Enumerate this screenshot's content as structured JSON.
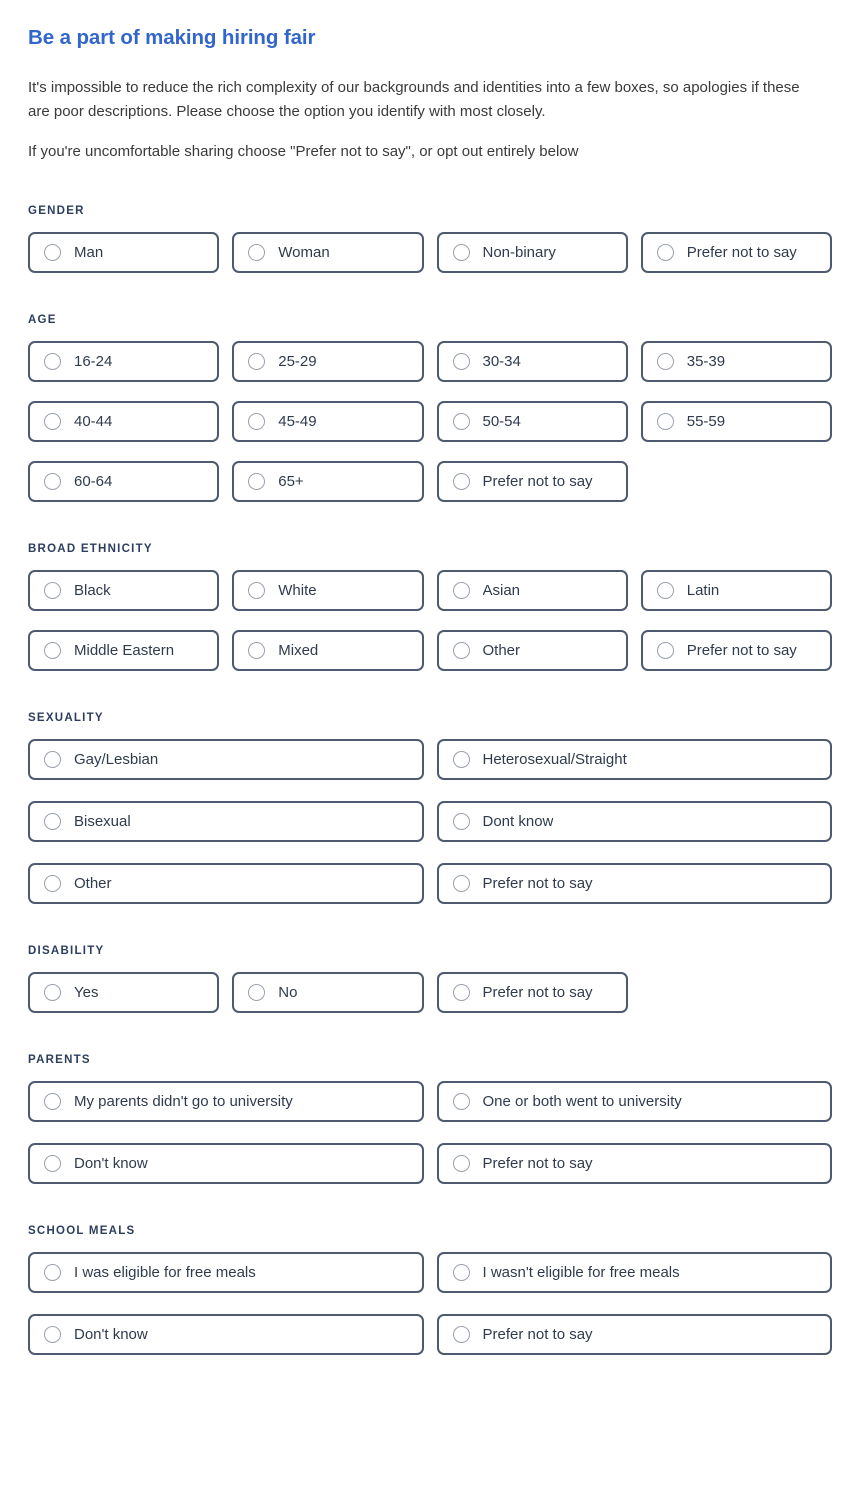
{
  "intro": {
    "title": "Be a part of making hiring fair",
    "paragraph_1": "It's impossible to reduce the rich complexity of our backgrounds and identities into a few boxes, so apologies if these are poor descriptions. Please choose the option you identify with most closely.",
    "paragraph_2": "If you're uncomfortable sharing choose \"Prefer not to say\", or opt out entirely below"
  },
  "colors": {
    "heading_blue": "#3366cc",
    "section_label": "#2c3e5d",
    "option_border": "#4d5a70",
    "option_text": "#2f3b4d",
    "radio_border": "#9aa1ad",
    "body_text": "#3a3a3a",
    "background": "#ffffff"
  },
  "sections": [
    {
      "id": "gender",
      "label": "GENDER",
      "columns": 4,
      "options": [
        {
          "label": "Man",
          "selected": false
        },
        {
          "label": "Woman",
          "selected": false
        },
        {
          "label": "Non-binary",
          "selected": false
        },
        {
          "label": "Prefer not to say",
          "selected": false
        }
      ]
    },
    {
      "id": "age",
      "label": "AGE",
      "columns": 4,
      "options": [
        {
          "label": "16-24",
          "selected": false
        },
        {
          "label": "25-29",
          "selected": false
        },
        {
          "label": "30-34",
          "selected": false
        },
        {
          "label": "35-39",
          "selected": false
        },
        {
          "label": "40-44",
          "selected": false
        },
        {
          "label": "45-49",
          "selected": false
        },
        {
          "label": "50-54",
          "selected": false
        },
        {
          "label": "55-59",
          "selected": false
        },
        {
          "label": "60-64",
          "selected": false
        },
        {
          "label": "65+",
          "selected": false
        },
        {
          "label": "Prefer not to say",
          "selected": false
        }
      ]
    },
    {
      "id": "broad-ethnicity",
      "label": "BROAD ETHNICITY",
      "columns": 4,
      "options": [
        {
          "label": "Black",
          "selected": false
        },
        {
          "label": "White",
          "selected": false
        },
        {
          "label": "Asian",
          "selected": false
        },
        {
          "label": "Latin",
          "selected": false
        },
        {
          "label": "Middle Eastern",
          "selected": false
        },
        {
          "label": "Mixed",
          "selected": false
        },
        {
          "label": "Other",
          "selected": false
        },
        {
          "label": "Prefer not to say",
          "selected": false
        }
      ]
    },
    {
      "id": "sexuality",
      "label": "SEXUALITY",
      "columns": 2,
      "options": [
        {
          "label": "Gay/Lesbian",
          "selected": false
        },
        {
          "label": "Heterosexual/Straight",
          "selected": false
        },
        {
          "label": "Bisexual",
          "selected": false
        },
        {
          "label": "Dont know",
          "selected": false
        },
        {
          "label": "Other",
          "selected": false
        },
        {
          "label": "Prefer not to say",
          "selected": false
        }
      ]
    },
    {
      "id": "disability",
      "label": "DISABILITY",
      "columns": 4,
      "options": [
        {
          "label": "Yes",
          "selected": false
        },
        {
          "label": "No",
          "selected": false
        },
        {
          "label": "Prefer not to say",
          "selected": false
        }
      ]
    },
    {
      "id": "parents",
      "label": "PARENTS",
      "columns": 2,
      "options": [
        {
          "label": "My parents didn't go to university",
          "selected": false
        },
        {
          "label": "One or both went to university",
          "selected": false
        },
        {
          "label": "Don't know",
          "selected": false
        },
        {
          "label": "Prefer not to say",
          "selected": false
        }
      ]
    },
    {
      "id": "school-meals",
      "label": "SCHOOL MEALS",
      "columns": 2,
      "options": [
        {
          "label": "I was eligible for free meals",
          "selected": false
        },
        {
          "label": "I wasn't eligible for free meals",
          "selected": false
        },
        {
          "label": "Don't know",
          "selected": false
        },
        {
          "label": "Prefer not to say",
          "selected": false
        }
      ]
    }
  ]
}
